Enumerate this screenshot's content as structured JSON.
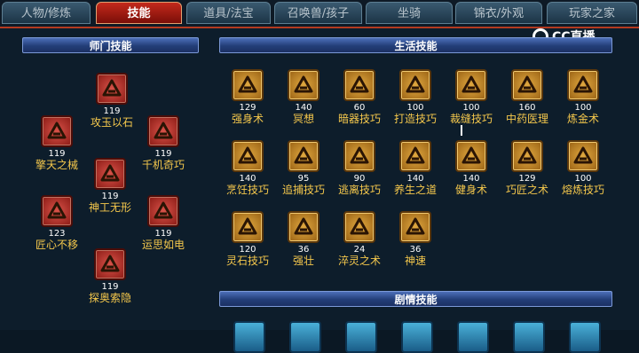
{
  "tabs": [
    {
      "label": "人物/修炼",
      "active": false
    },
    {
      "label": "技能",
      "active": true
    },
    {
      "label": "道具/法宝",
      "active": false
    },
    {
      "label": "召唤兽/孩子",
      "active": false
    },
    {
      "label": "坐骑",
      "active": false
    },
    {
      "label": "锦衣/外观",
      "active": false
    },
    {
      "label": "玩家之家",
      "active": false
    }
  ],
  "watermark": "CC直播",
  "sections": {
    "school": "师门技能",
    "life": "生活技能",
    "story": "剧情技能"
  },
  "school_skills": [
    {
      "name": "攻玉以石",
      "level": "119"
    },
    {
      "name": "擎天之械",
      "level": "119"
    },
    {
      "name": "千机奇巧",
      "level": "119"
    },
    {
      "name": "神工无形",
      "level": "119"
    },
    {
      "name": "匠心不移",
      "level": "123"
    },
    {
      "name": "运思如电",
      "level": "119"
    },
    {
      "name": "探奥索隐",
      "level": "119"
    }
  ],
  "life_skills": [
    {
      "name": "强身术",
      "level": "129"
    },
    {
      "name": "冥想",
      "level": "140"
    },
    {
      "name": "暗器技巧",
      "level": "60"
    },
    {
      "name": "打造技巧",
      "level": "100"
    },
    {
      "name": "裁缝技巧",
      "level": "100"
    },
    {
      "name": "中药医理",
      "level": "160"
    },
    {
      "name": "炼金术",
      "level": "100"
    },
    {
      "name": "烹饪技巧",
      "level": "140"
    },
    {
      "name": "追捕技巧",
      "level": "95"
    },
    {
      "name": "逃离技巧",
      "level": "90"
    },
    {
      "name": "养生之道",
      "level": "140"
    },
    {
      "name": "健身术",
      "level": "140"
    },
    {
      "name": "巧匠之术",
      "level": "129"
    },
    {
      "name": "熔炼技巧",
      "level": "100"
    },
    {
      "name": "灵石技巧",
      "level": "120"
    },
    {
      "name": "强壮",
      "level": "36"
    },
    {
      "name": "淬灵之术",
      "level": "24"
    },
    {
      "name": "神速",
      "level": "36"
    }
  ],
  "colors": {
    "accent_red": "#b43a20",
    "skill_name": "#f5c84c",
    "section_blue": "#233e78"
  }
}
